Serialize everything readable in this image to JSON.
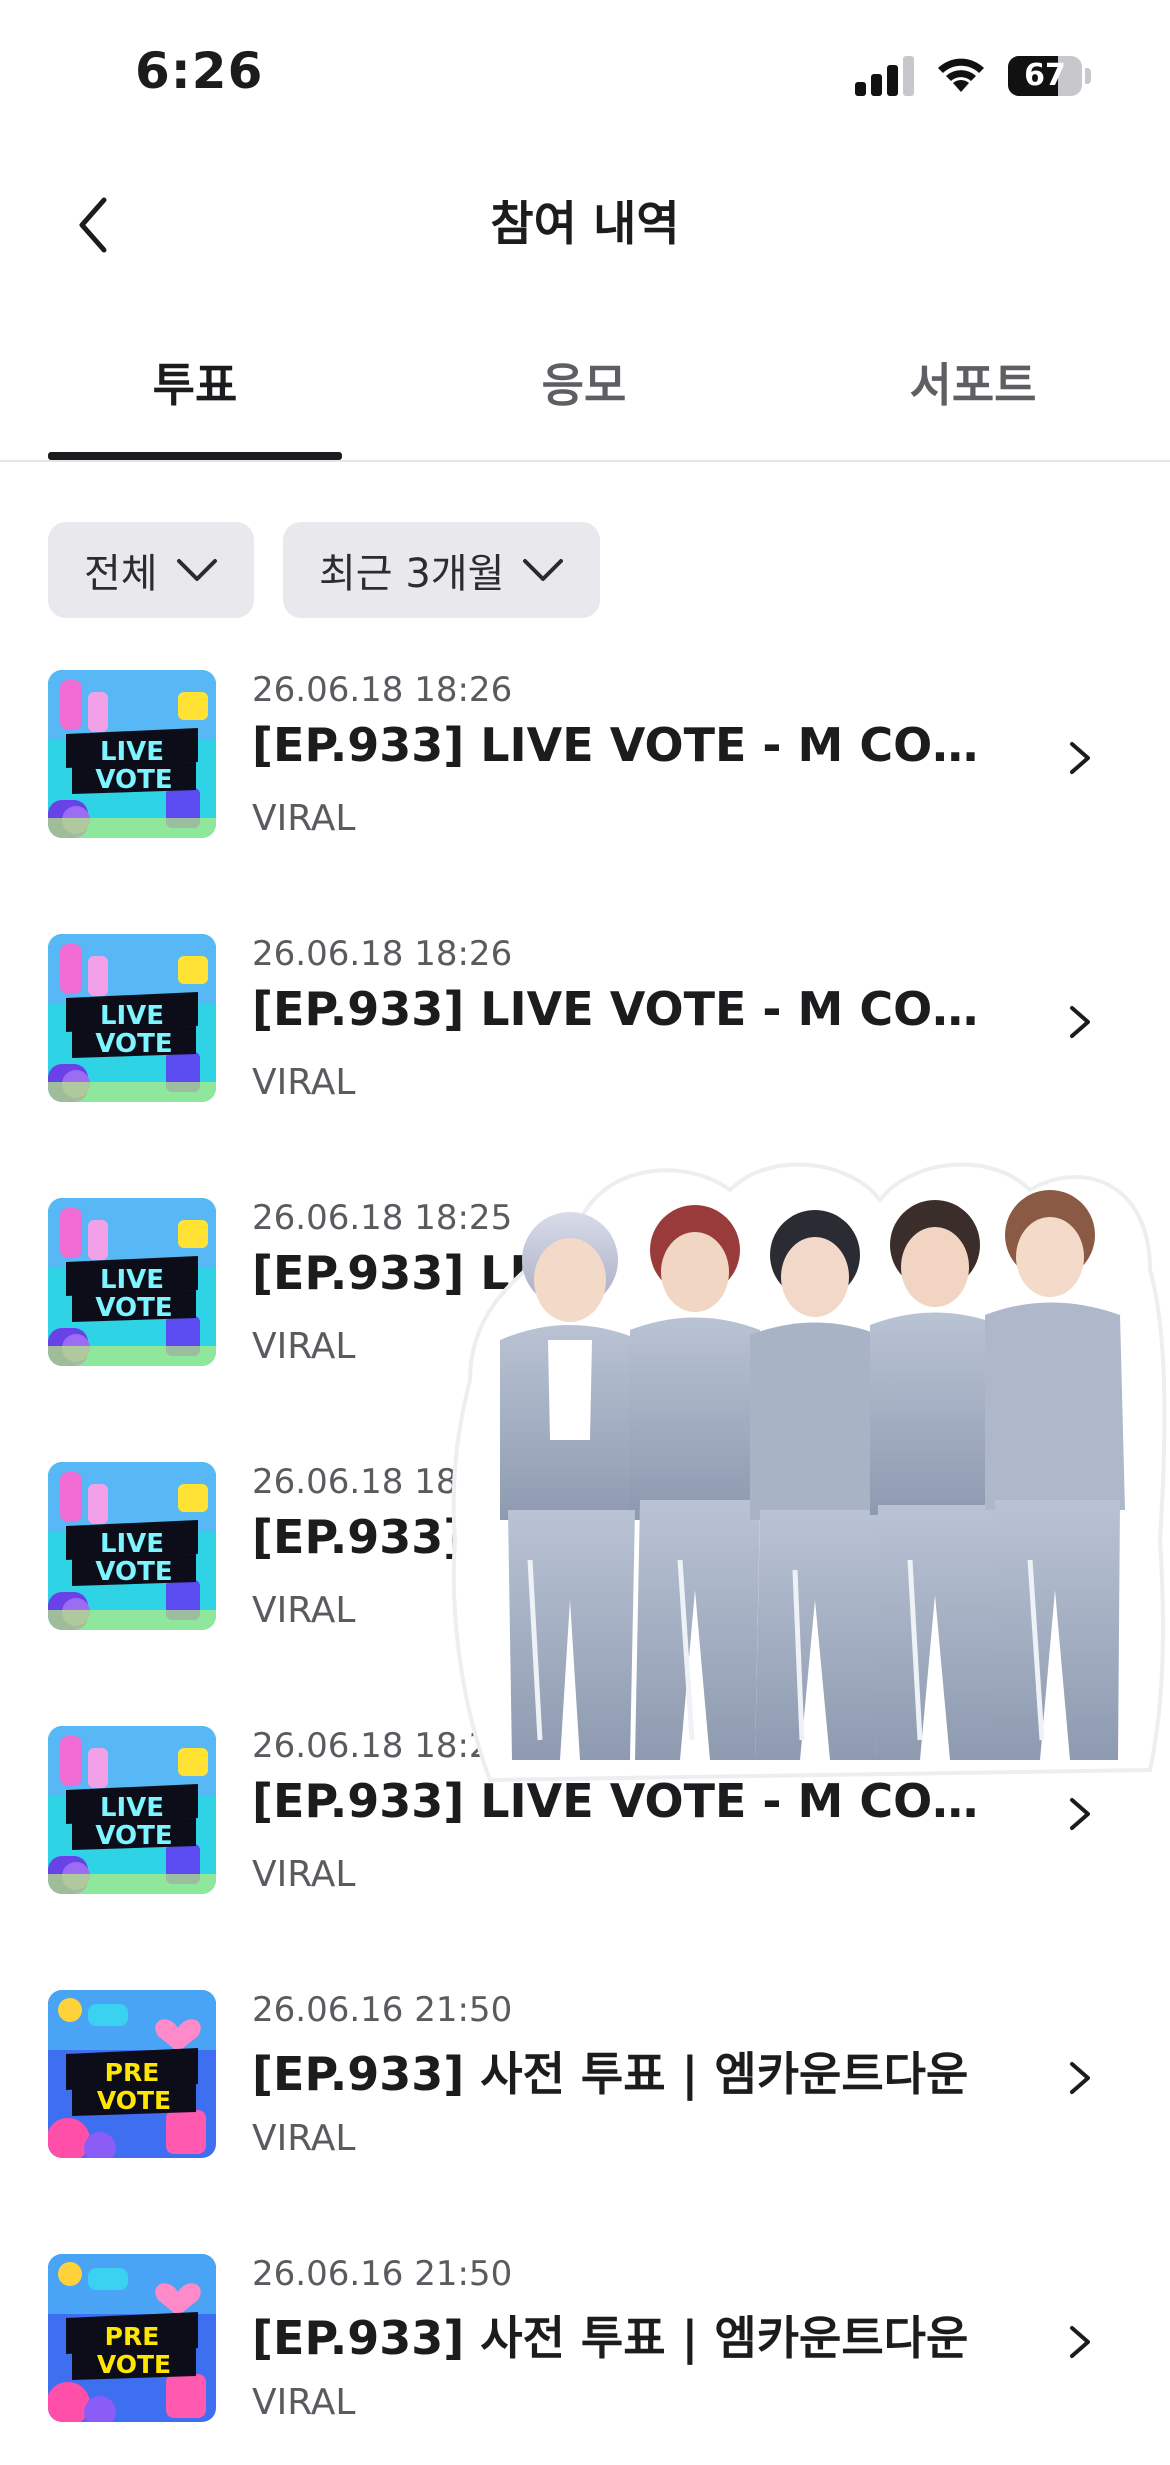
{
  "status_bar": {
    "time": "6:26",
    "battery": "67",
    "battery_level": 67
  },
  "header": {
    "title": "참여 내역",
    "back_icon": "chevron-left-icon"
  },
  "tabs": [
    {
      "label": "투표",
      "active": true
    },
    {
      "label": "응모",
      "active": false
    },
    {
      "label": "서포트",
      "active": false
    }
  ],
  "filters": [
    {
      "label": "전체"
    },
    {
      "label": "최근 3개월"
    }
  ],
  "items": [
    {
      "date": "26.06.18 18:26",
      "title": "[EP.933] LIVE VOTE - M COUN...",
      "source": "VIRAL",
      "thumb": "live-vote",
      "thumb_line1": "LIVE",
      "thumb_line2": "VOTE"
    },
    {
      "date": "26.06.18 18:26",
      "title": "[EP.933] LIVE VOTE - M COUN...",
      "source": "VIRAL",
      "thumb": "live-vote",
      "thumb_line1": "LIVE",
      "thumb_line2": "VOTE"
    },
    {
      "date": "26.06.18 18:25",
      "title": "[EP.933] LIVE VOTE - M COUN...",
      "source": "VIRAL",
      "thumb": "live-vote",
      "thumb_line1": "LIVE",
      "thumb_line2": "VOTE"
    },
    {
      "date": "26.06.18 18:25",
      "title": "[EP.933] LIVE VOTE - M COUN...",
      "source": "VIRAL",
      "thumb": "live-vote",
      "thumb_line1": "LIVE",
      "thumb_line2": "VOTE"
    },
    {
      "date": "26.06.18 18:25",
      "title": "[EP.933] LIVE VOTE - M COUN...",
      "source": "VIRAL",
      "thumb": "live-vote",
      "thumb_line1": "LIVE",
      "thumb_line2": "VOTE"
    },
    {
      "date": "26.06.16 21:50",
      "title": "[EP.933] 사전 투표 | 엠카운트다운",
      "source": "VIRAL",
      "thumb": "pre-vote",
      "thumb_line1": "PRE",
      "thumb_line2": "VOTE"
    },
    {
      "date": "26.06.16 21:50",
      "title": "[EP.933] 사전 투표 | 엠카운트다운",
      "source": "VIRAL",
      "thumb": "pre-vote",
      "thumb_line1": "PRE",
      "thumb_line2": "VOTE"
    }
  ],
  "colors": {
    "live_bg": "#2ed3e6",
    "pre_bg": "#3d6ff0",
    "pre_label": "#ffe600",
    "indicator": "#1c1c1e",
    "chip_bg": "#e9e9ed"
  }
}
